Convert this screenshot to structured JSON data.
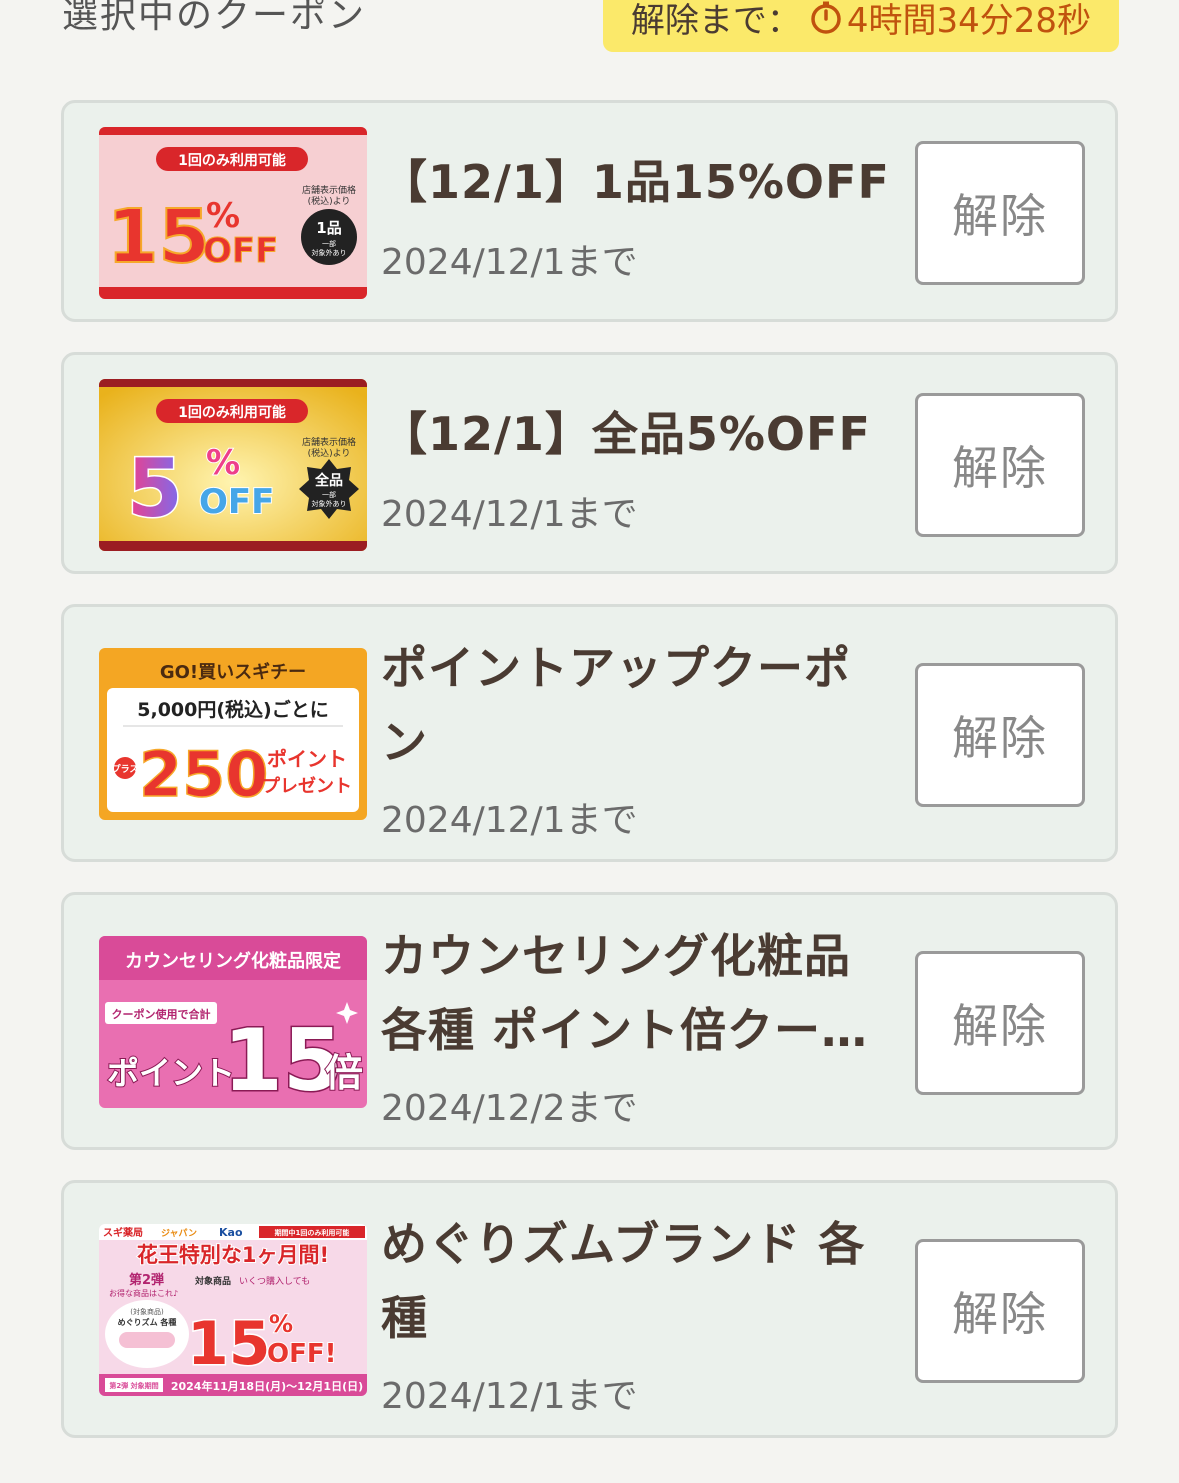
{
  "header": {
    "title": "選択中のクーポン",
    "timer_label": "解除まで：",
    "timer_icon": "clock-icon",
    "timer_value": "4時間34分28秒"
  },
  "coupons": [
    {
      "title": "【12/1】1品15%OFF",
      "expiry": "2024/12/1まで",
      "button": "解除",
      "image": {
        "badge": "1回のみ利用可能",
        "big": "15",
        "pct": "%",
        "off": "OFF",
        "note1": "店舗表示価格",
        "note2": "(税込)より",
        "circle1": "1品",
        "circle2": "一部",
        "circle3": "対象外あり"
      }
    },
    {
      "title": "【12/1】全品5%OFF",
      "expiry": "2024/12/1まで",
      "button": "解除",
      "image": {
        "badge": "1回のみ利用可能",
        "big": "5",
        "pct": "%",
        "off": "OFF",
        "note1": "店舗表示価格",
        "note2": "(税込)より",
        "circle1": "全品",
        "circle2": "一部",
        "circle3": "対象外あり"
      }
    },
    {
      "title": "ポイントアップクーポン",
      "expiry": "2024/12/1まで",
      "button": "解除",
      "image": {
        "top": "GO!買いスギチー",
        "line": "5,000円(税込)ごとに",
        "plus": "プラス",
        "big": "250",
        "unit1": "ポイント",
        "unit2": "プレゼント"
      }
    },
    {
      "title": "カウンセリング化粧品各種 ポイント倍クーポン",
      "expiry": "2024/12/2まで",
      "button": "解除",
      "image": {
        "top": "カウンセリング化粧品限定",
        "small": "クーポン使用で合計",
        "word": "ポイント",
        "big": "15",
        "unit": "倍"
      }
    },
    {
      "title": "めぐりズムブランド 各種",
      "expiry": "2024/12/1まで",
      "button": "解除",
      "image": {
        "brand1": "スギ薬局",
        "brand2": "ジャパン",
        "brand3": "Kao",
        "top_right": "期間中1回のみ利用可能",
        "headline": "花王特別な1ヶ月間!",
        "phase": "第2弾",
        "phase_sub": "お得な商品はこれ♪",
        "target": "対象商品",
        "target_sub": "いくつ購入しても",
        "product1": "(対象商品)",
        "product2": "めぐりズム 各種",
        "big": "15",
        "pct": "%",
        "off": "OFF!",
        "period_tag": "第2弾 対象期間",
        "period": "2024年11月18日(月)〜12月1日(日)"
      }
    }
  ]
}
